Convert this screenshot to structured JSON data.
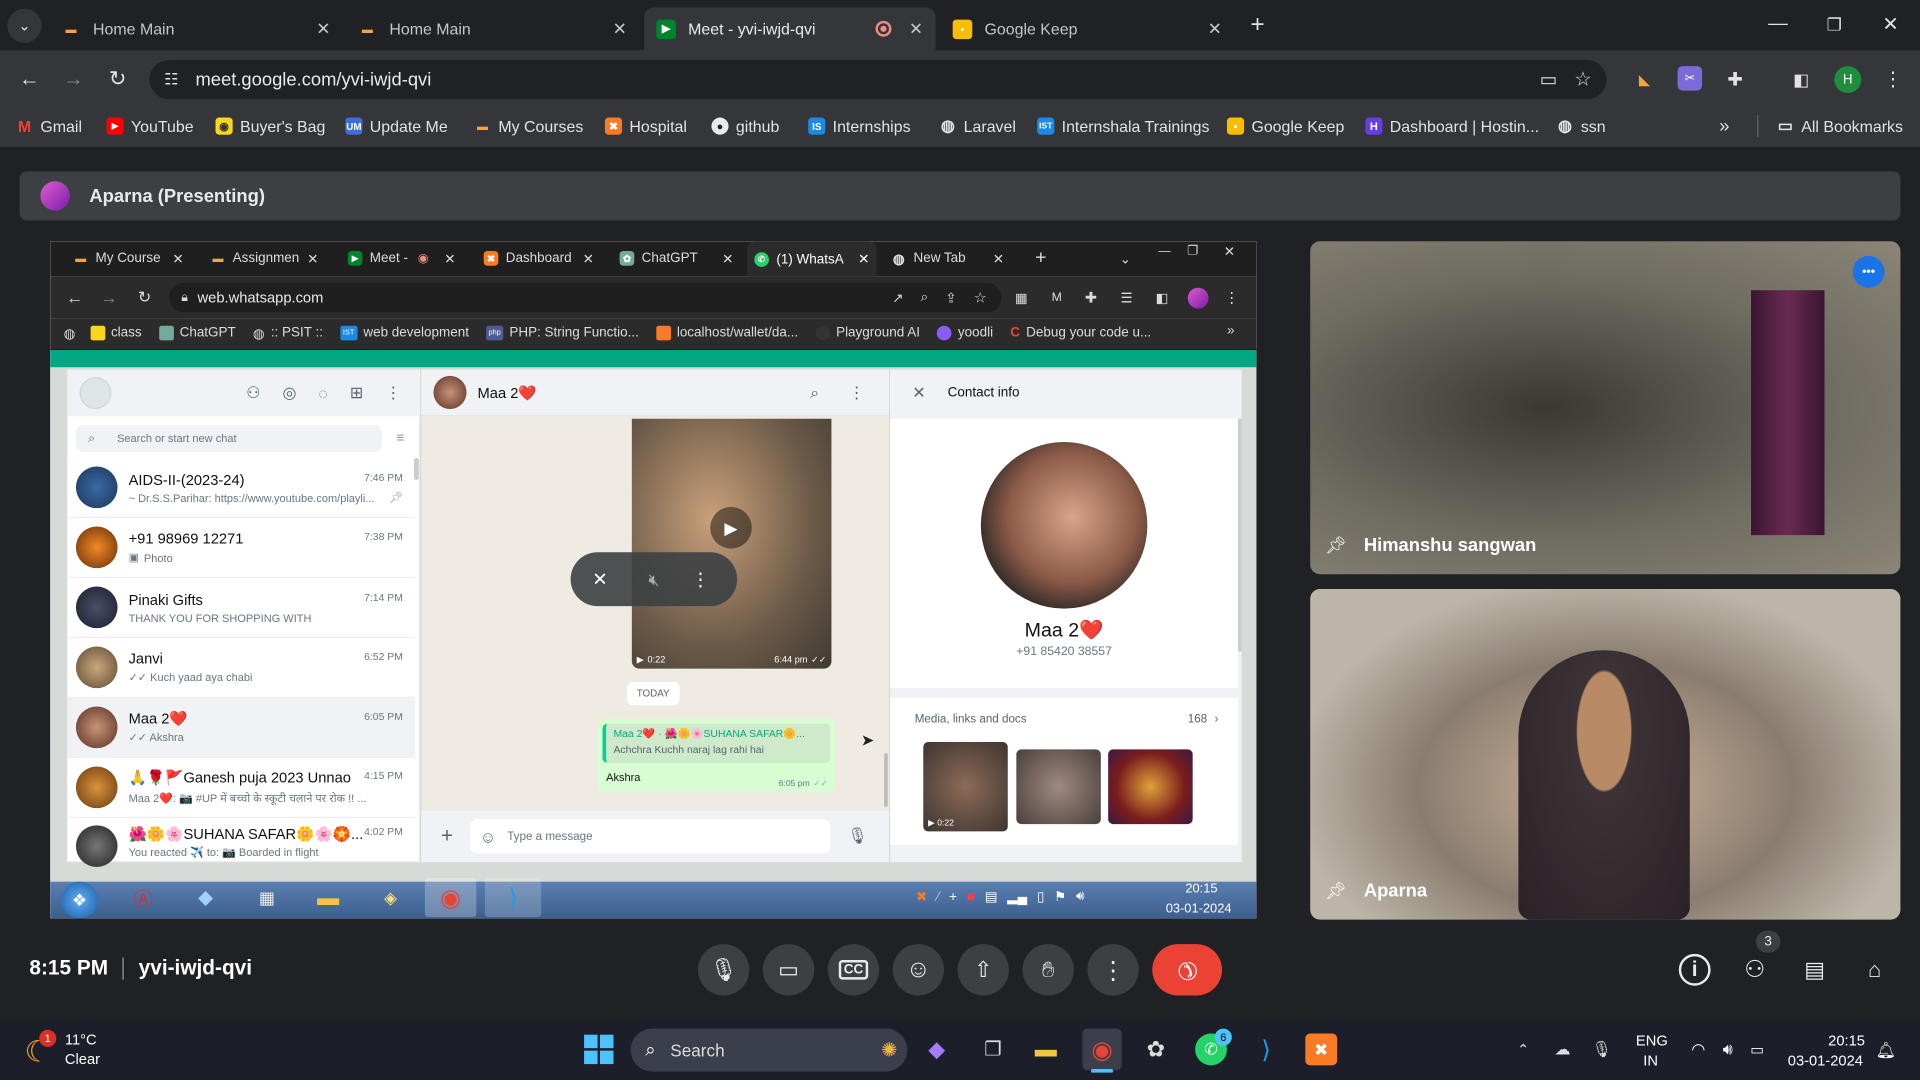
{
  "browser": {
    "tabs": [
      {
        "title": "Home Main",
        "active": false
      },
      {
        "title": "Home Main",
        "active": false
      },
      {
        "title": "Meet - yvi-iwjd-qvi",
        "active": true
      },
      {
        "title": "Google Keep",
        "active": false
      }
    ],
    "url": "meet.google.com/yvi-iwjd-qvi",
    "profile_initial": "H",
    "bookmarks": [
      "Gmail",
      "YouTube",
      "Buyer's Bag",
      "Update Me",
      "My Courses",
      "Hospital",
      "github",
      "Internships",
      "Laravel",
      "Internshala Trainings",
      "Google Keep",
      "Dashboard | Hostin...",
      "ssn"
    ],
    "bookmark_icons": [
      "UM",
      "IS",
      "IST"
    ],
    "all_bookmarks": "All Bookmarks"
  },
  "meet": {
    "presenter": "Aparna (Presenting)",
    "time": "8:15 PM",
    "meeting_code": "yvi-iwjd-qvi",
    "participants_count": "3",
    "tiles": [
      {
        "name": "Himanshu sangwan"
      },
      {
        "name": "Aparna"
      }
    ],
    "more_dots": "•••"
  },
  "shared": {
    "tabs": [
      "My Course",
      "Assignmen",
      "Meet -",
      "Dashboard",
      "ChatGPT",
      "(1) WhatsA",
      "New Tab"
    ],
    "url": "web.whatsapp.com",
    "bookmarks": [
      "class",
      "ChatGPT",
      ":: PSIT ::",
      "web development",
      "PHP: String Functio...",
      "localhost/wallet/da...",
      "Playground AI",
      "yoodli",
      "Debug your code u..."
    ],
    "bookmark_icons": [
      "IST",
      "php"
    ],
    "whatsapp": {
      "search_placeholder": "Search or start new chat",
      "chats": [
        {
          "name": "AIDS-II-(2023-24)",
          "time": "7:46 PM",
          "preview": "~ Dr.S.S.Parihar: https://www.youtube.com/playli..."
        },
        {
          "name": "+91 98969 12271",
          "time": "7:38 PM",
          "preview": "Photo"
        },
        {
          "name": "Pinaki Gifts",
          "time": "7:14 PM",
          "preview": "THANK YOU FOR SHOPPING WITH"
        },
        {
          "name": "Janvi",
          "time": "6:52 PM",
          "preview": "✓✓ Kuch yaad aya chabi"
        },
        {
          "name": "Maa 2❤️",
          "time": "6:05 PM",
          "preview": "✓✓ Akshra"
        },
        {
          "name": "🙏🌹🚩Ganesh puja 2023 Unnao",
          "time": "4:15 PM",
          "preview": "Maa 2❤️: 📷 #UP में बच्चो के स्कूटी चलाने पर रोक !! ..."
        },
        {
          "name": "🌺🌼🌸SUHANA SAFAR🌼🌸🏵️...",
          "time": "4:02 PM",
          "preview": "You reacted ✈️ to: 📷 Boarded in flight"
        }
      ],
      "conversation": {
        "name": "Maa 2❤️",
        "video_duration": "0:22",
        "video_time": "6:44 pm",
        "day_label": "TODAY",
        "reply_sender": "Maa 2❤️ · 🌺🌼🌸SUHANA SAFAR🌼...",
        "reply_text": "Achchra Kuchh naraj lag rahi hai",
        "message": "Akshra",
        "message_time": "6:05 pm",
        "input_placeholder": "Type a message"
      },
      "contact_info": {
        "title": "Contact info",
        "name": "Maa 2❤️",
        "phone": "+91 85420 38557",
        "media_label": "Media, links and docs",
        "media_count": "168",
        "media_thumb_duration": "0:22"
      }
    },
    "taskbar": {
      "time": "20:15",
      "date": "03-01-2024"
    }
  },
  "taskbar": {
    "weather_temp": "11°C",
    "weather_desc": "Clear",
    "weather_badge": "1",
    "search": "Search",
    "whatsapp_badge": "6",
    "lang": "ENG",
    "region": "IN",
    "time": "20:15",
    "date": "03-01-2024"
  }
}
